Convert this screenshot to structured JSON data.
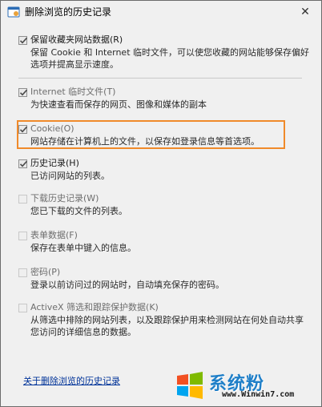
{
  "window": {
    "title": "删除浏览的历史记录",
    "close_glyph": "✕",
    "accent_highlight": "#f08a2a"
  },
  "options": [
    {
      "title": "保留收藏夹网站数据(R)",
      "description": "保留 Cookie 和 Internet 临时文件，可以使您收藏的网站能够保存偏好选项并提高显示速度。",
      "checked": true,
      "disabled": false
    },
    {
      "title": "Internet 临时文件(T)",
      "description": "为快速查看而保存的网页、图像和媒体的副本",
      "checked": true,
      "disabled": false
    },
    {
      "title": "Cookie(O)",
      "description": "网站存储在计算机上的文件，以保存如登录信息等首选项。",
      "checked": true,
      "disabled": false,
      "highlighted": true
    },
    {
      "title": "历史记录(H)",
      "description": "已访问网站的列表。",
      "checked": true,
      "disabled": false
    },
    {
      "title": "下载历史记录(W)",
      "description": "您已下载的文件的列表。",
      "checked": false,
      "disabled": false
    },
    {
      "title": "表单数据(F)",
      "description": "保存在表单中键入的信息。",
      "checked": false,
      "disabled": false
    },
    {
      "title": "密码(P)",
      "description": "登录以前访问过的网站时，自动填充保存的密码。",
      "checked": false,
      "disabled": false
    },
    {
      "title": "ActiveX 筛选和跟踪保护数据(K)",
      "description": "从筛选中排除的网站列表，以及跟踪保护用来检测网站在何处自动共享您访问的详细信息的数据。",
      "checked": false,
      "disabled": false
    }
  ],
  "footer": {
    "link_label": "关于删除浏览的历史记录"
  },
  "watermark": {
    "name": "系统粉",
    "url": "www.Winwin7.com"
  }
}
